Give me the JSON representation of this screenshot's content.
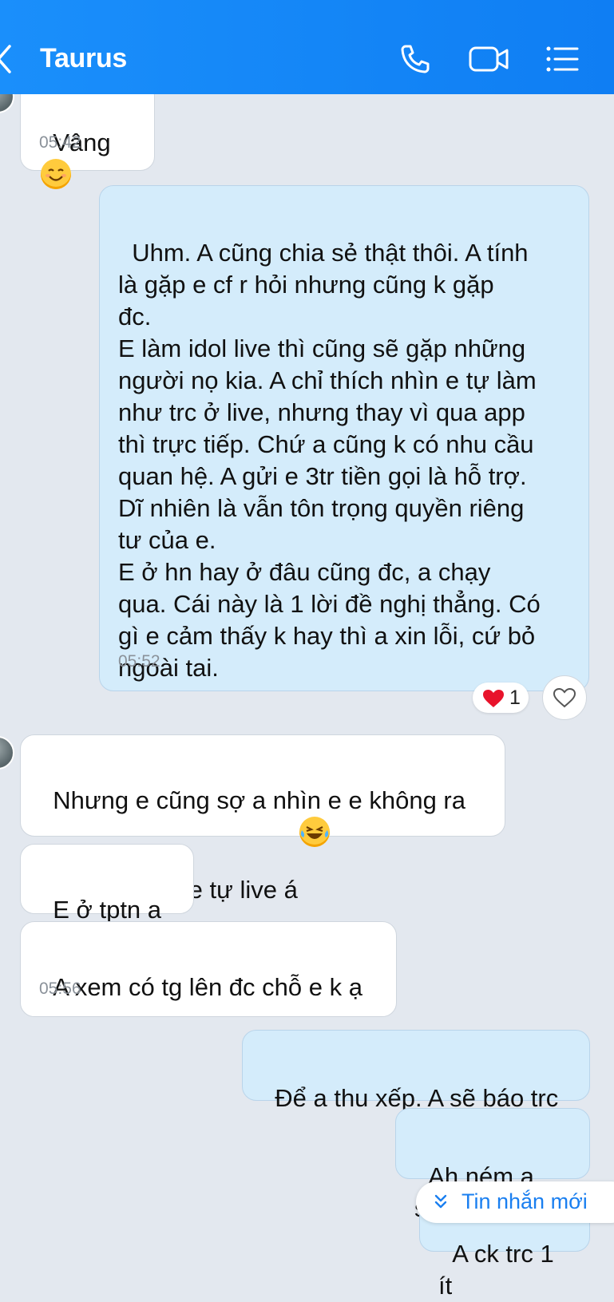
{
  "header": {
    "title": "Taurus",
    "icons": [
      "back-chevron-icon",
      "phone-icon",
      "video-call-icon",
      "menu-list-icon"
    ]
  },
  "messages": [
    {
      "dir": "in",
      "text": "Vâng",
      "time": "05:42",
      "emoji": "smiling-face-emoji"
    },
    {
      "dir": "out",
      "text": "Uhm. A cũng chia sẻ thật thôi. A tính\nlà gặp e cf r hỏi nhưng cũng k gặp\nđc.\nE làm idol live thì cũng sẽ gặp những\nngười nọ kia. A chỉ thích nhìn e tự làm\nnhư trc ở live, nhưng thay vì qua app\nthì trực tiếp. Chứ a cũng k có nhu cầu\nquan hệ. A gửi e 3tr tiền gọi là hỗ trợ.\nDĩ nhiên là vẫn tôn trọng quyền riêng\ntư của e.\nE ở hn hay ở đâu cũng đc, a chạy\nqua. Cái này là 1 lời đề nghị thẳng. Có\ngì e cảm thấy k hay thì a xin lỗi, cứ bỏ\nngoài tai.",
      "time": "05:52",
      "reaction_count": "1"
    },
    {
      "dir": "in",
      "text": "Nhưng e cũng sợ a nhìn e e không ra\nnước đc như e tự live á",
      "emoji": "laughing-tears-emoji"
    },
    {
      "dir": "in",
      "text": "E ở tptn a ạ"
    },
    {
      "dir": "in",
      "text": "A xem có tg lên đc chỗ e k ạ",
      "time": "05:56"
    },
    {
      "dir": "out",
      "text": "Để a thu xếp. A sẽ báo trc"
    },
    {
      "dir": "out",
      "text": "Ah ném a stk"
    },
    {
      "dir": "out",
      "text": "A ck trc 1 ít"
    }
  ],
  "new_messages_button": {
    "label": "Tin nhắn mới"
  },
  "colors": {
    "header": "#0f7ef3",
    "outgoing_bubble": "#d4ecfb",
    "incoming_bubble": "#ffffff",
    "background": "#e3e8ef"
  }
}
